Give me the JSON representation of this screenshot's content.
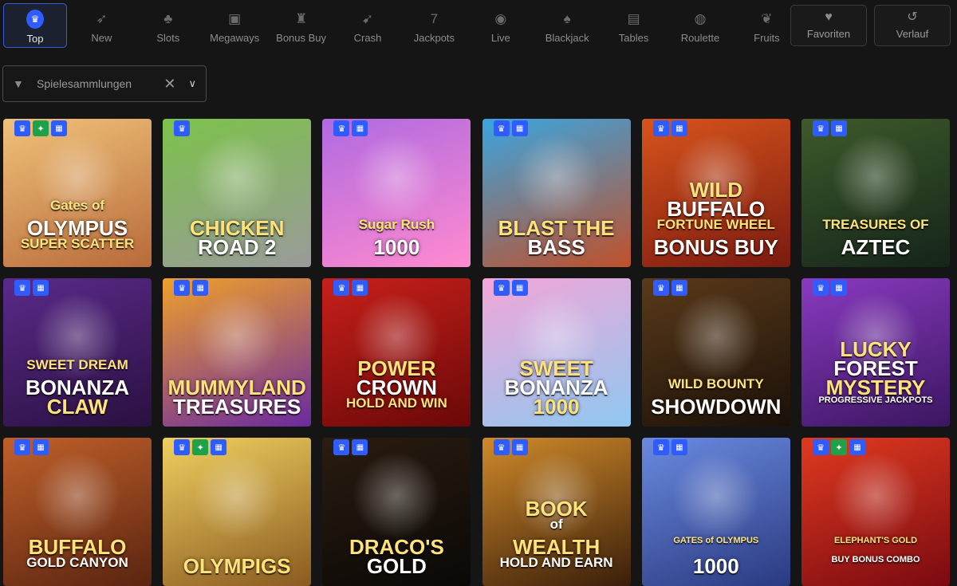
{
  "nav": {
    "categories": [
      {
        "label": "Top",
        "icon": "crown-icon"
      },
      {
        "label": "New",
        "icon": "rocket-icon"
      },
      {
        "label": "Slots",
        "icon": "cherry-icon"
      },
      {
        "label": "Megaways",
        "icon": "megaways-icon"
      },
      {
        "label": "Bonus Buy",
        "icon": "money-bag-icon"
      },
      {
        "label": "Crash",
        "icon": "rocket-launch-icon"
      },
      {
        "label": "Jackpots",
        "icon": "seven-icon"
      },
      {
        "label": "Live",
        "icon": "poker-chip-icon"
      },
      {
        "label": "Blackjack",
        "icon": "cards-icon"
      },
      {
        "label": "Tables",
        "icon": "table-icon"
      },
      {
        "label": "Roulette",
        "icon": "roulette-icon"
      },
      {
        "label": "Fruits",
        "icon": "fruit-icon"
      }
    ],
    "favorites_label": "Favoriten",
    "history_label": "Verlauf"
  },
  "filter": {
    "label": "Spielesammlungen"
  },
  "games": [
    {
      "title_lines": [
        "Gates of",
        "OLYMPUS",
        "SUPER SCATTER"
      ],
      "badges": [
        "crown",
        "new",
        "gift"
      ],
      "colors": [
        "#f0c27a",
        "#b86a3a"
      ]
    },
    {
      "title_lines": [
        "CHICKEN",
        "ROAD 2"
      ],
      "badges": [
        "crown"
      ],
      "colors": [
        "#7cc24a",
        "#9a9a9a"
      ]
    },
    {
      "title_lines": [
        "Sugar Rush",
        "1000"
      ],
      "badges": [
        "crown",
        "gift"
      ],
      "colors": [
        "#b06ae0",
        "#ff8ad0"
      ]
    },
    {
      "title_lines": [
        "BLAST THE",
        "BASS"
      ],
      "badges": [
        "crown",
        "gift"
      ],
      "colors": [
        "#3aa5e0",
        "#c0502a"
      ]
    },
    {
      "title_lines": [
        "WILD",
        "BUFFALO",
        "FORTUNE WHEEL",
        "BONUS BUY"
      ],
      "badges": [
        "crown",
        "gift"
      ],
      "colors": [
        "#d8541c",
        "#7a1a10"
      ]
    },
    {
      "title_lines": [
        "TREASURES OF",
        "AZTEC"
      ],
      "badges": [
        "crown",
        "gift"
      ],
      "colors": [
        "#3e5a2a",
        "#14241a"
      ]
    },
    {
      "title_lines": [
        "SWEET DREAM",
        "BONANZA",
        "CLAW"
      ],
      "badges": [
        "crown",
        "gift"
      ],
      "colors": [
        "#5a2a8a",
        "#2a1040"
      ]
    },
    {
      "title_lines": [
        "MUMMYLAND",
        "TREASURES"
      ],
      "badges": [
        "crown",
        "gift"
      ],
      "colors": [
        "#f0a02a",
        "#6a2aa0"
      ]
    },
    {
      "title_lines": [
        "POWER",
        "CROWN",
        "HOLD AND WIN"
      ],
      "badges": [
        "crown",
        "gift"
      ],
      "colors": [
        "#c8201a",
        "#6a0808"
      ]
    },
    {
      "title_lines": [
        "SWEET",
        "BONANZA",
        "1000"
      ],
      "badges": [
        "crown",
        "gift"
      ],
      "colors": [
        "#f3a6d8",
        "#8fc8f0"
      ]
    },
    {
      "title_lines": [
        "WILD BOUNTY",
        "SHOWDOWN"
      ],
      "badges": [
        "crown",
        "gift"
      ],
      "colors": [
        "#5a3a1a",
        "#1a1008"
      ]
    },
    {
      "title_lines": [
        "LUCKY",
        "FOREST",
        "MYSTERY",
        "PROGRESSIVE JACKPOTS"
      ],
      "badges": [
        "crown",
        "gift"
      ],
      "colors": [
        "#8a3ac0",
        "#3a1660"
      ]
    },
    {
      "title_lines": [
        "BUFFALO",
        "GOLD CANYON"
      ],
      "badges": [
        "crown",
        "gift"
      ],
      "colors": [
        "#c0602a",
        "#5a2410"
      ]
    },
    {
      "title_lines": [
        "OLYMPIGS"
      ],
      "badges": [
        "crown",
        "new",
        "gift"
      ],
      "colors": [
        "#f0d060",
        "#8a5a20"
      ]
    },
    {
      "title_lines": [
        "DRACO'S",
        "GOLD"
      ],
      "badges": [
        "crown",
        "gift"
      ],
      "colors": [
        "#2a1c10",
        "#0a0806"
      ]
    },
    {
      "title_lines": [
        "BOOK",
        "of",
        "WEALTH",
        "HOLD AND EARN"
      ],
      "badges": [
        "crown",
        "gift"
      ],
      "colors": [
        "#d08a2a",
        "#3a1e0a"
      ]
    },
    {
      "title_lines": [
        "GATES of OLYMPUS",
        "1000"
      ],
      "badges": [
        "crown",
        "gift"
      ],
      "colors": [
        "#6a8ae0",
        "#2a3a80"
      ]
    },
    {
      "title_lines": [
        "ELEPHANT'S GOLD",
        "BUY BONUS COMBO"
      ],
      "badges": [
        "crown",
        "new",
        "gift"
      ],
      "colors": [
        "#e03a20",
        "#7a0a10"
      ]
    }
  ]
}
